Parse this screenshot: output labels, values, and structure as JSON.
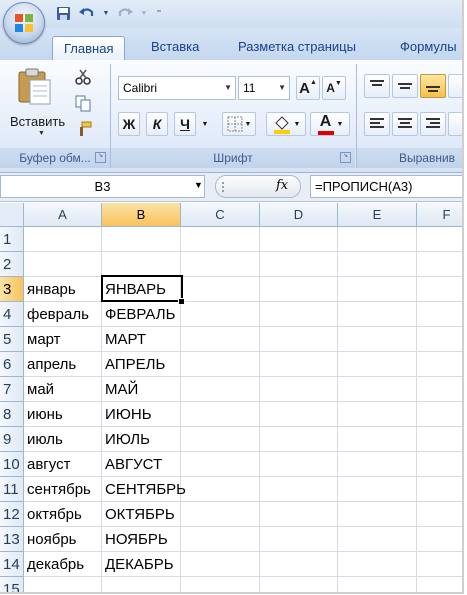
{
  "qat": {
    "icons": [
      "save-icon",
      "undo-icon",
      "redo-icon",
      "customize-icon"
    ]
  },
  "tabs": [
    {
      "label": "Главная",
      "active": true
    },
    {
      "label": "Вставка"
    },
    {
      "label": "Разметка страницы"
    },
    {
      "label": "Формулы"
    }
  ],
  "ribbon": {
    "clipboard": {
      "paste_label": "Вставить",
      "group_label": "Буфер обм..."
    },
    "font": {
      "font_name": "Calibri",
      "font_size": "11",
      "bold": "Ж",
      "italic": "К",
      "underline": "Ч",
      "grow": "A",
      "shrink": "A",
      "font_color_letter": "A",
      "group_label": "Шрифт"
    },
    "alignment": {
      "group_label": "Выравнив"
    }
  },
  "formula_bar": {
    "name_box": "B3",
    "fx_label": "fx",
    "formula": "=ПРОПИСН(A3)"
  },
  "sheet": {
    "columns": [
      "A",
      "B",
      "C",
      "D",
      "E",
      "F"
    ],
    "selected_column": "B",
    "selected_row": "3",
    "rows": [
      {
        "num": "1",
        "a": "",
        "b": ""
      },
      {
        "num": "2",
        "a": "",
        "b": ""
      },
      {
        "num": "3",
        "a": "январь",
        "b": "ЯНВАРЬ"
      },
      {
        "num": "4",
        "a": "февраль",
        "b": "ФЕВРАЛЬ"
      },
      {
        "num": "5",
        "a": "март",
        "b": "МАРТ"
      },
      {
        "num": "6",
        "a": "апрель",
        "b": "АПРЕЛЬ"
      },
      {
        "num": "7",
        "a": "май",
        "b": "МАЙ"
      },
      {
        "num": "8",
        "a": "июнь",
        "b": "ИЮНЬ"
      },
      {
        "num": "9",
        "a": "июль",
        "b": "ИЮЛЬ"
      },
      {
        "num": "10",
        "a": "август",
        "b": "АВГУСТ"
      },
      {
        "num": "11",
        "a": "сентябрь",
        "b": "СЕНТЯБРЬ"
      },
      {
        "num": "12",
        "a": "октябрь",
        "b": "ОКТЯБРЬ"
      },
      {
        "num": "13",
        "a": "ноябрь",
        "b": "НОЯБРЬ"
      },
      {
        "num": "14",
        "a": "декабрь",
        "b": "ДЕКАБРЬ"
      },
      {
        "num": "15",
        "a": "",
        "b": ""
      }
    ]
  },
  "colors": {
    "accent": "#15428b",
    "selection": "#f8c35d",
    "highlight": "#ffcc00",
    "font_red": "#e00000"
  }
}
